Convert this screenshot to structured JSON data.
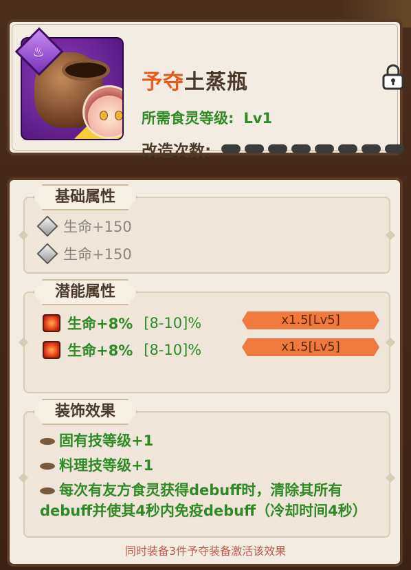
{
  "item": {
    "name_prefix": "予夺",
    "name_rest": "土蒸瓶",
    "requirement_label": "所需食灵等级:",
    "requirement_value": "Lv1",
    "modify_label": "改造次数:",
    "modify_pips": 8
  },
  "basic": {
    "title": "基础属性",
    "stats": [
      "生命+150",
      "生命+150"
    ]
  },
  "potential": {
    "title": "潜能属性",
    "stats": [
      {
        "label": "生命+8%",
        "range": "[8-10]%",
        "bonus": "x1.5[Lv5]"
      },
      {
        "label": "生命+8%",
        "range": "[8-10]%",
        "bonus": "x1.5[Lv5]"
      }
    ]
  },
  "decoration": {
    "title": "装饰效果",
    "effects": [
      "固有技等级+1",
      "料理技等级+1",
      "每次有友方食灵获得debuff时，清除其所有debuff并使其4秒内免疫debuff（冷却时间4秒）"
    ]
  },
  "footer": "同时装备3件予夺装备激活该效果",
  "icons": [
    "steam-bowl-icon",
    "lock-icon",
    "diamond-icon",
    "ruby-icon",
    "bean-bullet-icon"
  ],
  "colors": {
    "prefix": "#e65a1c",
    "green": "#2f8a26",
    "badge": "#f07a3e",
    "footer": "#c0584a"
  }
}
